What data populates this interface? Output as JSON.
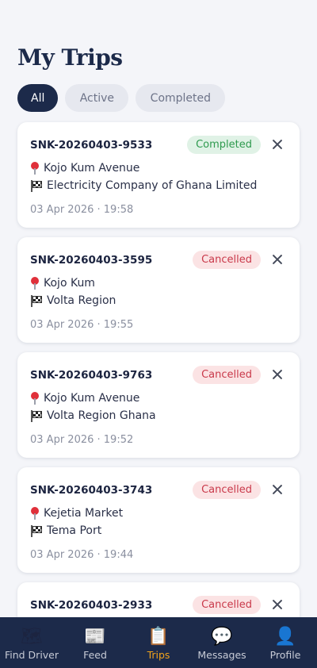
{
  "page": {
    "title": "My Trips"
  },
  "tabs": [
    {
      "label": "All",
      "selected": true
    },
    {
      "label": "Active",
      "selected": false
    },
    {
      "label": "Completed",
      "selected": false
    }
  ],
  "trips": [
    {
      "id": "SNK-20260403-9533",
      "status": "Completed",
      "status_type": "completed",
      "from": "Kojo Kum Avenue",
      "to": "Electricity Company of Ghana Limited",
      "time": "03 Apr 2026 · 19:58"
    },
    {
      "id": "SNK-20260403-3595",
      "status": "Cancelled",
      "status_type": "cancelled",
      "from": "Kojo Kum",
      "to": "Volta Region",
      "time": "03 Apr 2026 · 19:55"
    },
    {
      "id": "SNK-20260403-9763",
      "status": "Cancelled",
      "status_type": "cancelled",
      "from": "Kojo Kum Avenue",
      "to": "Volta Region Ghana",
      "time": "03 Apr 2026 · 19:52"
    },
    {
      "id": "SNK-20260403-3743",
      "status": "Cancelled",
      "status_type": "cancelled",
      "from": "Kejetia Market",
      "to": "Tema Port",
      "time": "03 Apr 2026 · 19:44"
    },
    {
      "id": "SNK-20260403-2933",
      "status": "Cancelled",
      "status_type": "cancelled",
      "from": "",
      "to": "",
      "time": ""
    }
  ],
  "nav": [
    {
      "label": "Find Driver",
      "icon": "map-icon",
      "glyph": "🗺",
      "active": false
    },
    {
      "label": "Feed",
      "icon": "newspaper-icon",
      "glyph": "📰",
      "active": false
    },
    {
      "label": "Trips",
      "icon": "clipboard-icon",
      "glyph": "📋",
      "active": true
    },
    {
      "label": "Messages",
      "icon": "chat-icon",
      "glyph": "💬",
      "active": false
    },
    {
      "label": "Profile",
      "icon": "person-icon",
      "glyph": "👤",
      "active": false
    }
  ],
  "colors": {
    "navy": "#1c2a4a",
    "accent": "#f0a31c",
    "completed": "#2e9a4e",
    "cancelled": "#c9394a"
  }
}
